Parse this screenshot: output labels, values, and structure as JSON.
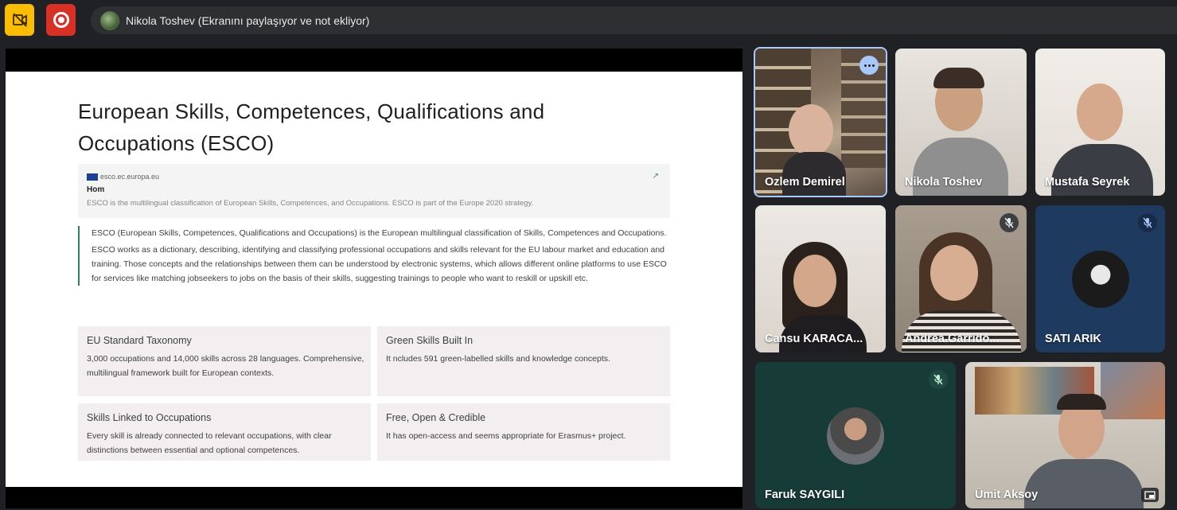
{
  "topbar": {
    "camera_icon": "camera-off-icon",
    "record_icon": "record-icon",
    "presenter_status": "Nikola Toshev (Ekranını paylaşıyor ve not ekliyor)"
  },
  "slide": {
    "title": "European Skills, Competences, Qualifications and Occupations (ESCO)",
    "link_card": {
      "domain": "esco.ec.europa.eu",
      "heading": "Hom",
      "description": "ESCO is the multilingual classification of European Skills, Competences, and Occupations. ESCO is part of the Europe 2020 strategy."
    },
    "quote": {
      "p1": "ESCO (European Skills, Competences, Qualifications and Occupations) is the European multilingual classification of Skills, Competences and Occupations.",
      "p2": "ESCO works as a dictionary, describing, identifying and classifying professional occupations and skills relevant for the EU labour market and education and training.  Those concepts and the relationships between them can be understood by electronic systems, which allows different online platforms to use ESCO for services like matching jobseekers to jobs on the basis of their skills, suggesting trainings to people who want to reskill or upskill etc."
    },
    "features": [
      {
        "title": "EU Standard Taxonomy",
        "text": "3,000 occupations and 14,000 skills across 28 languages. Comprehensive, multilingual framework built for European contexts."
      },
      {
        "title": "Green Skills Built In",
        "text": "It ncludes 591 green-labelled skills and knowledge concepts."
      },
      {
        "title": "Skills Linked to Occupations",
        "text": "Every skill is already connected to relevant occupations, with clear distinctions between essential and optional competences."
      },
      {
        "title": "Free, Open & Credible",
        "text": "It has open-access and seems appropriate for Erasmus+ project."
      }
    ]
  },
  "participants": [
    {
      "name": "Ozlem Demirel",
      "muted": false,
      "active_speaker": true
    },
    {
      "name": "Nikola Toshev",
      "muted": false
    },
    {
      "name": "Mustafa Seyrek",
      "muted": false
    },
    {
      "name": "Cansu KARACA...",
      "muted": false
    },
    {
      "name": "Andrea Garrido...",
      "muted": true
    },
    {
      "name": "SATI ARIK",
      "muted": true
    },
    {
      "name": "Faruk SAYGILI",
      "muted": true
    },
    {
      "name": "Ümit Aksoy",
      "muted": false
    }
  ],
  "colors": {
    "accent_yellow": "#fbbc04",
    "accent_red": "#d93025",
    "active_speaker_border": "#a8c7fa",
    "quote_border": "#2f7d72"
  }
}
